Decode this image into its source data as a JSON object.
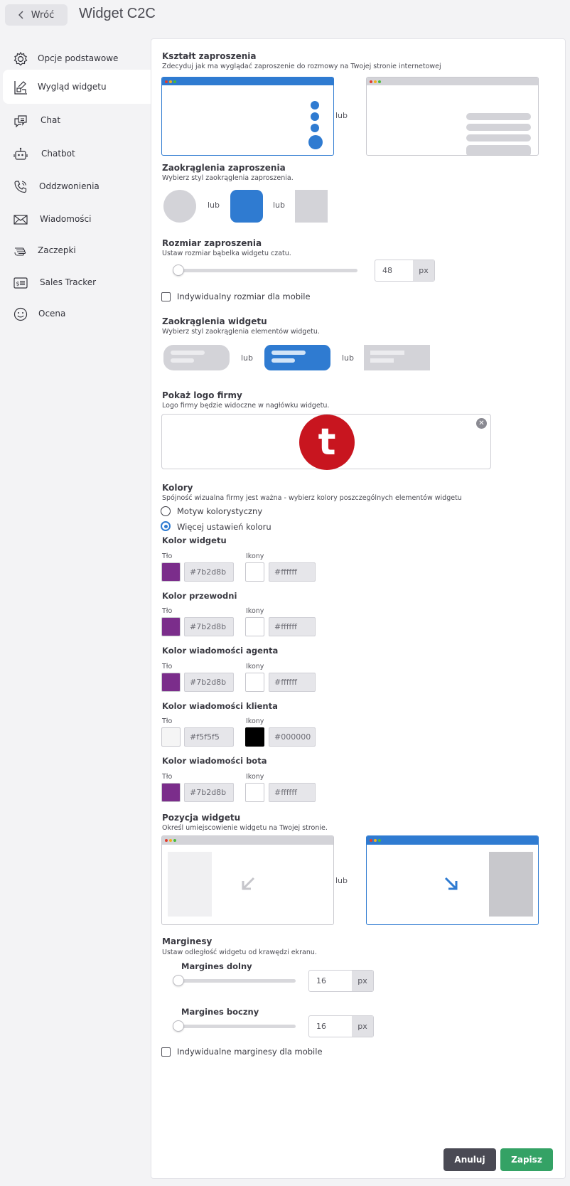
{
  "header": {
    "back_label": "Wróć",
    "title": "Widget C2C"
  },
  "sidebar": {
    "items": [
      {
        "label": "Opcje podstawowe",
        "icon": "gear-icon"
      },
      {
        "label": "Wygląd widgetu",
        "icon": "appearance-icon",
        "active": true
      },
      {
        "label": "Chat",
        "icon": "chat-icon"
      },
      {
        "label": "Chatbot",
        "icon": "robot-icon"
      },
      {
        "label": "Oddzwonienia",
        "icon": "phone-icon"
      },
      {
        "label": "Wiadomości",
        "icon": "envelope-icon"
      },
      {
        "label": "Zaczepki",
        "icon": "hand-icon"
      },
      {
        "label": "Sales Tracker",
        "icon": "dollar-card-icon"
      },
      {
        "label": "Ocena",
        "icon": "smiley-icon"
      }
    ]
  },
  "or_label": "lub",
  "invitation_shape": {
    "title": "Kształt zaproszenia",
    "desc": "Zdecyduj jak ma wyglądać zaproszenie do rozmowy na Twojej stronie internetowej"
  },
  "invitation_rounding": {
    "title": "Zaokrąglenia zaproszenia",
    "desc": "Wybierz styl zaokrąglenia zaproszenia."
  },
  "invitation_size": {
    "title": "Rozmiar zaproszenia",
    "desc": "Ustaw rozmiar bąbelka widgetu czatu.",
    "value": "48",
    "unit": "px",
    "mobile_label": "Indywidualny rozmiar dla mobile"
  },
  "widget_rounding": {
    "title": "Zaokrąglenia widgetu",
    "desc": "Wybierz styl zaokrąglenia elementów widgetu."
  },
  "logo": {
    "title": "Pokaż logo firmy",
    "desc": "Logo firmy będzie widoczne w nagłówku widgetu.",
    "glyph": "t",
    "color": "#c8151f"
  },
  "colors": {
    "title": "Kolory",
    "desc": "Spójność wizualna firmy jest ważna - wybierz kolory poszczególnych elementów widgetu",
    "option_theme": "Motyw kolorystyczny",
    "option_more": "Więcej ustawień koloru",
    "bg_label": "Tło",
    "icons_label": "Ikony",
    "groups": [
      {
        "title": "Kolor widgetu",
        "bg": "#7b2d8b",
        "icons": "#ffffff"
      },
      {
        "title": "Kolor przewodni",
        "bg": "#7b2d8b",
        "icons": "#ffffff"
      },
      {
        "title": "Kolor wiadomości agenta",
        "bg": "#7b2d8b",
        "icons": "#ffffff"
      },
      {
        "title": "Kolor wiadomości klienta",
        "bg": "#f5f5f5",
        "icons": "#000000"
      },
      {
        "title": "Kolor wiadomości bota",
        "bg": "#7b2d8b",
        "icons": "#ffffff"
      }
    ]
  },
  "position": {
    "title": "Pozycja widgetu",
    "desc": "Określ umiejscowienie widgetu na Twojej stronie."
  },
  "margins": {
    "title": "Marginesy",
    "desc": "Ustaw odległość widgetu od krawędzi ekranu.",
    "bottom_label": "Margines dolny",
    "bottom_value": "16",
    "side_label": "Margines boczny",
    "side_value": "16",
    "unit": "px",
    "mobile_label": "Indywidualne marginesy dla mobile"
  },
  "actions": {
    "cancel": "Anuluj",
    "save": "Zapisz"
  },
  "accent": "#2f7bd1"
}
